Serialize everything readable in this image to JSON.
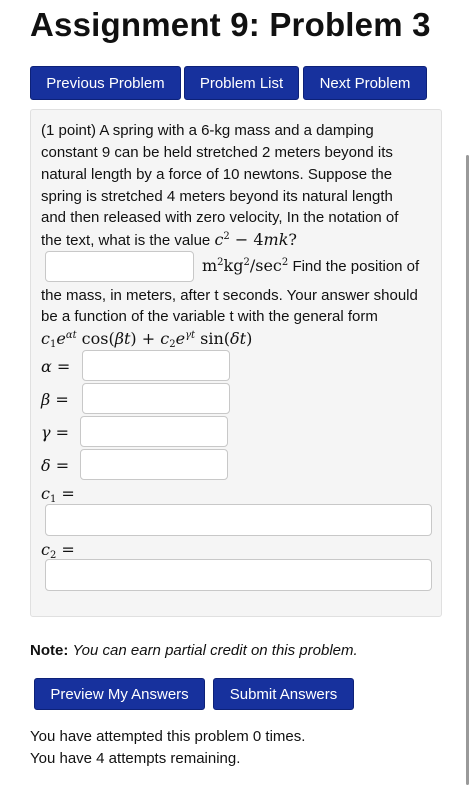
{
  "page": {
    "title": "Assignment 9: Problem 3"
  },
  "nav": {
    "previous_label": "Previous Problem",
    "list_label": "Problem List",
    "next_label": "Next Problem"
  },
  "problem": {
    "lines": [
      "(1 point) A spring with a 6-kg mass and a damping",
      "constant 9 can be held stretched 2 meters beyond its",
      "natural length by a force of 10 newtons. Suppose the",
      "spring is stretched 4 meters beyond its natural length",
      "and then released with zero velocity, In the notation of",
      "the text, what is the value",
      "Find the position of",
      "the mass, in meters, after t seconds. Your answer should",
      "be a function of the variable t with the general form"
    ],
    "expr_value": "c² − 4mk?",
    "units": "m²kg²/sec²",
    "general_form": "c₁e^(αt)cos(βt) + c₂e^(γt)sin(δt)",
    "fields": {
      "value": "",
      "alpha": "",
      "beta": "",
      "gamma": "",
      "delta": "",
      "c1": "",
      "c2": ""
    },
    "labels": {
      "alpha": "α =",
      "beta": "β =",
      "gamma": "γ =",
      "delta": "δ =",
      "c1": "c₁ =",
      "c2": "c₂ ="
    }
  },
  "note": {
    "bold": "Note:",
    "text": "You can earn partial credit on this problem."
  },
  "actions": {
    "preview_label": "Preview My Answers",
    "submit_label": "Submit Answers"
  },
  "status": {
    "attempted": "You have attempted this problem 0 times.",
    "remaining": "You have 4 attempts remaining."
  }
}
